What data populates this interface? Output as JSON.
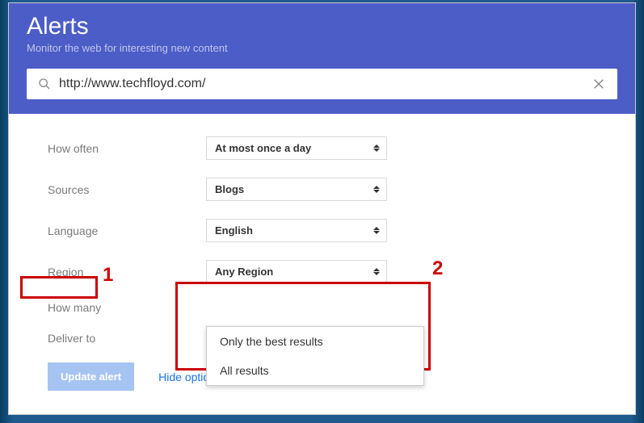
{
  "header": {
    "title": "Alerts",
    "subtitle": "Monitor the web for interesting new content"
  },
  "search": {
    "value": "http://www.techfloyd.com/"
  },
  "form": {
    "rows": [
      {
        "label": "How often",
        "value": "At most once a day"
      },
      {
        "label": "Sources",
        "value": "Blogs"
      },
      {
        "label": "Language",
        "value": "English"
      },
      {
        "label": "Region",
        "value": "Any Region"
      },
      {
        "label": "How many",
        "value": ""
      },
      {
        "label": "Deliver to",
        "value": ""
      }
    ]
  },
  "dropdown": {
    "options": [
      "Only the best results",
      "All results"
    ]
  },
  "actions": {
    "update": "Update alert",
    "hide": "Hide options"
  },
  "annotations": {
    "one": "1",
    "two": "2"
  }
}
